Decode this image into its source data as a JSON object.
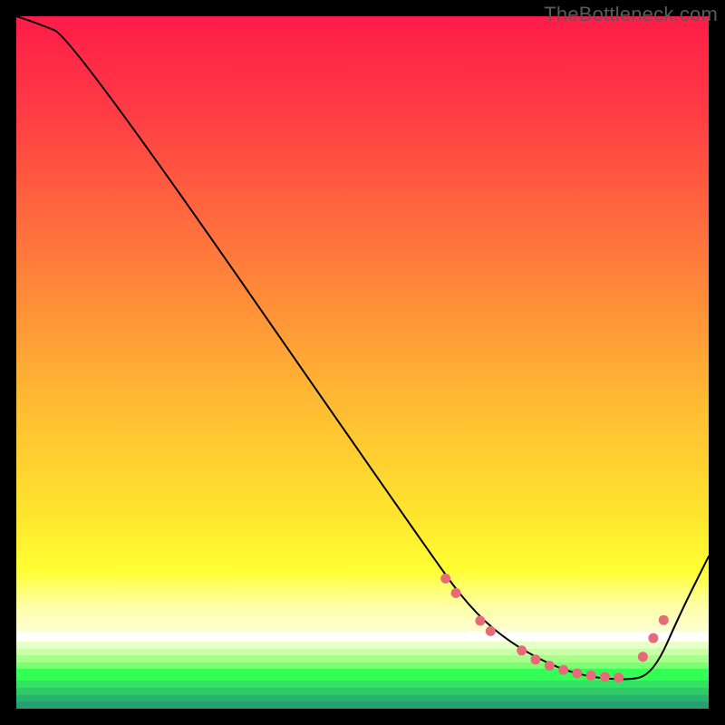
{
  "watermark": "TheBottleneck.com",
  "chart_data": {
    "type": "line",
    "title": "",
    "xlabel": "",
    "ylabel": "",
    "xlim": [
      0,
      100
    ],
    "ylim": [
      0,
      100
    ],
    "x": [
      0,
      3,
      8,
      60,
      66,
      72,
      80,
      88,
      92,
      96,
      100
    ],
    "values": [
      100,
      99,
      97,
      22,
      14,
      9,
      5,
      4,
      5,
      14,
      22
    ],
    "marker_points": {
      "x": [
        62,
        63.5,
        67,
        68.5,
        73,
        75,
        77,
        79,
        81,
        83,
        85,
        87,
        90.5,
        92,
        93.5
      ],
      "y": [
        18.8,
        16.7,
        12.7,
        11.2,
        8.4,
        7.1,
        6.2,
        5.6,
        5.1,
        4.8,
        4.6,
        4.5,
        7.5,
        10.2,
        12.8
      ]
    },
    "gradient_stops": [
      {
        "pct": 0,
        "color": "#ff1c49"
      },
      {
        "pct": 15,
        "color": "#ff3f44"
      },
      {
        "pct": 35,
        "color": "#ff7b3b"
      },
      {
        "pct": 55,
        "color": "#ffb833"
      },
      {
        "pct": 72,
        "color": "#ffe52e"
      },
      {
        "pct": 80,
        "color": "#ffff33"
      },
      {
        "pct": 85,
        "color": "#feffa3"
      },
      {
        "pct": 89,
        "color": "#feffd6"
      }
    ],
    "bottom_bands": [
      {
        "top_pct": 89.0,
        "height_pct": 1.3,
        "color": "#ffffff"
      },
      {
        "top_pct": 90.3,
        "height_pct": 1.0,
        "color": "#e8ffc8"
      },
      {
        "top_pct": 91.3,
        "height_pct": 1.0,
        "color": "#c8ffa8"
      },
      {
        "top_pct": 92.3,
        "height_pct": 1.0,
        "color": "#a6ff8a"
      },
      {
        "top_pct": 93.3,
        "height_pct": 1.0,
        "color": "#7cff70"
      },
      {
        "top_pct": 94.3,
        "height_pct": 1.7,
        "color": "#33ff57"
      },
      {
        "top_pct": 96.0,
        "height_pct": 1.0,
        "color": "#33e262"
      },
      {
        "top_pct": 97.0,
        "height_pct": 1.0,
        "color": "#2fc96a"
      },
      {
        "top_pct": 98.0,
        "height_pct": 1.0,
        "color": "#2ab36f"
      },
      {
        "top_pct": 99.0,
        "height_pct": 1.0,
        "color": "#26a071"
      }
    ]
  }
}
